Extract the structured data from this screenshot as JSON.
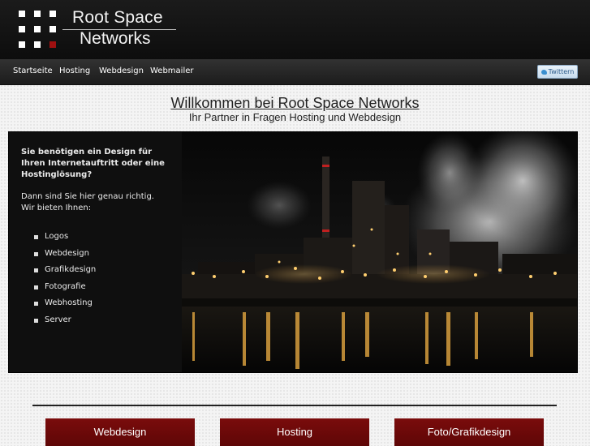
{
  "header": {
    "logo_line1": "Root Space",
    "logo_line2": "Networks"
  },
  "nav": {
    "items": [
      "Startseite",
      "Hosting",
      "Webdesign",
      "Webmailer"
    ],
    "twitter_label": "Twittern"
  },
  "main": {
    "title": "Willkommen bei Root Space Networks",
    "subtitle": "Ihr Partner in Fragen Hosting und Webdesign"
  },
  "hero": {
    "intro": "Sie benötigen ein Design für Ihren Internetauftritt oder eine Hostinglösung?",
    "intro2_line1": "Dann sind Sie hier genau richtig.",
    "intro2_line2": "Wir bieten Ihnen:",
    "services": [
      "Logos",
      "Webdesign",
      "Grafikdesign",
      "Fotografie",
      "Webhosting",
      "Server"
    ]
  },
  "buttons": [
    "Webdesign",
    "Hosting",
    "Foto/Grafikdesign"
  ],
  "colors": {
    "header_bg": "#111111",
    "accent_red": "#7a0c0c",
    "logo_red_square": "#a01010"
  }
}
